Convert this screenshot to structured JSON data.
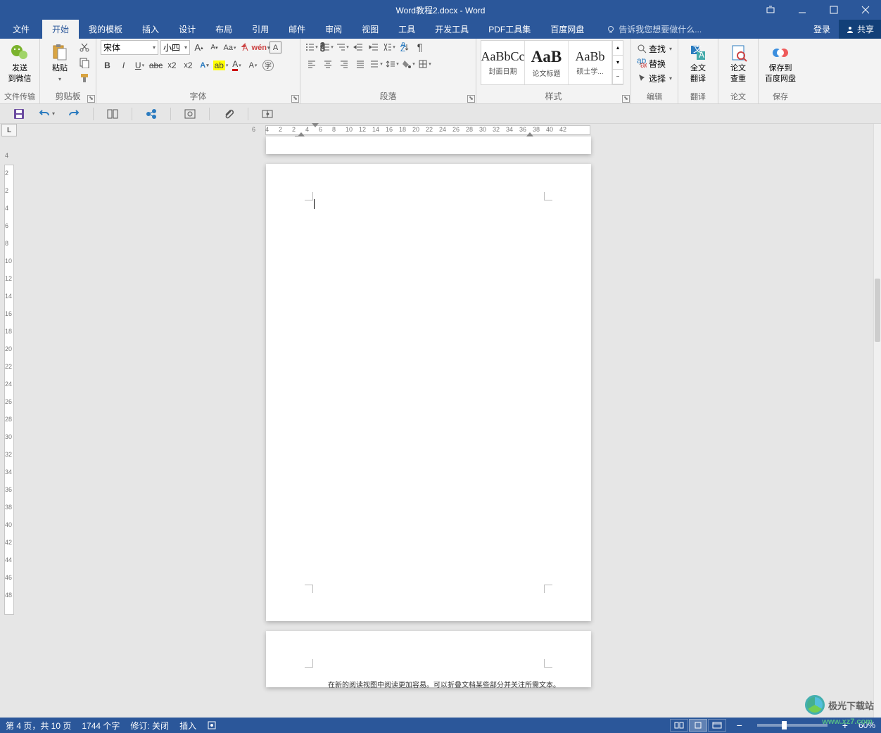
{
  "title": "Word教程2.docx - Word",
  "win_controls": {
    "restore_down": "❐"
  },
  "tabs": {
    "file": "文件",
    "home": "开始",
    "templates": "我的模板",
    "insert": "插入",
    "design": "设计",
    "layout": "布局",
    "references": "引用",
    "mail": "邮件",
    "review": "审阅",
    "view": "视图",
    "tools": "工具",
    "dev": "开发工具",
    "pdf": "PDF工具集",
    "baidu": "百度网盘"
  },
  "search_hint": "告诉我您想要做什么...",
  "login": "登录",
  "share": "共享",
  "groups": {
    "filetrans": "文件传输",
    "clipboard": "剪贴板",
    "font": "字体",
    "paragraph": "段落",
    "styles": "样式",
    "editing": "编辑",
    "translate": "翻译",
    "thesis": "论文",
    "save": "保存"
  },
  "big": {
    "wechat1": "发送",
    "wechat2": "到微信",
    "paste": "粘贴",
    "fulltrans1": "全文",
    "fulltrans2": "翻译",
    "thesis1": "论文",
    "thesis2": "查重",
    "savebd1": "保存到",
    "savebd2": "百度网盘"
  },
  "font": {
    "name": "宋体",
    "size": "小四",
    "grow": "A",
    "shrink": "A",
    "case": "Aa",
    "clear": "A",
    "phonetic": "拼",
    "border": "A"
  },
  "styles": [
    {
      "prev": "AaBbCc",
      "name": "封面日期",
      "cls": ""
    },
    {
      "prev": "AaB",
      "name": "论文标题",
      "cls": "bold"
    },
    {
      "prev": "AaBb",
      "name": "硕士学...",
      "cls": ""
    }
  ],
  "editing": {
    "find": "查找",
    "replace": "替换",
    "select": "选择"
  },
  "ruler_h": [
    "6",
    "4",
    "2",
    "2",
    "4",
    "6",
    "8",
    "10",
    "12",
    "14",
    "16",
    "18",
    "20",
    "22",
    "24",
    "26",
    "28",
    "30",
    "32",
    "34",
    "36",
    "38",
    "40",
    "42"
  ],
  "ruler_v": [
    "4",
    "2",
    "2",
    "4",
    "6",
    "8",
    "10",
    "12",
    "14",
    "16",
    "18",
    "20",
    "22",
    "24",
    "26",
    "28",
    "30",
    "32",
    "34",
    "36",
    "38",
    "40",
    "42",
    "44",
    "46",
    "48"
  ],
  "doc_text": "在新的阅读视图中阅读更加容易。可以折叠文档某些部分并关注所需文本。",
  "status": {
    "page": "第 4 页，共 10 页",
    "words": "1744 个字",
    "track": "修订: 关闭",
    "mode": "插入"
  },
  "zoom": "60%",
  "watermark": {
    "text": "极光下载站",
    "url": "www.xz7.com"
  }
}
